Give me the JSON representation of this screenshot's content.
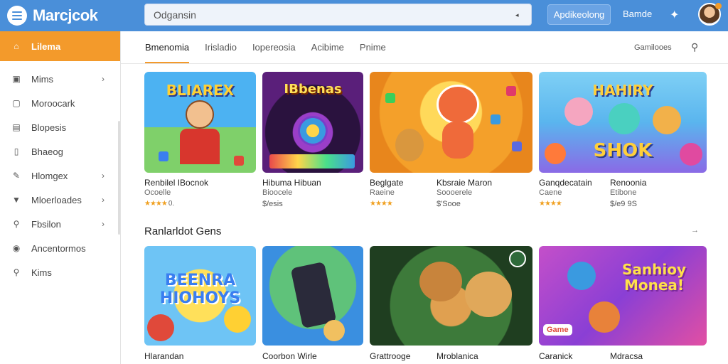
{
  "app": {
    "name": "Marcjcok"
  },
  "header": {
    "search_value": "Odgansin",
    "apps_button": "Apdikeolong",
    "games_link": "Bamde"
  },
  "sidebar": {
    "items": [
      {
        "label": "Lilema",
        "icon": "home-icon",
        "active": true,
        "chevron": false
      },
      {
        "label": "Mims",
        "icon": "image-icon",
        "chevron": true
      },
      {
        "label": "Moroocark",
        "icon": "window-icon",
        "chevron": false
      },
      {
        "label": "Blopesis",
        "icon": "document-icon",
        "chevron": false
      },
      {
        "label": "Bhaeog",
        "icon": "lock-icon",
        "chevron": false
      },
      {
        "label": "Hlomgex",
        "icon": "pen-icon",
        "chevron": true
      },
      {
        "label": "Mloerloades",
        "icon": "filter-icon",
        "chevron": true
      },
      {
        "label": "Fbsilon",
        "icon": "search-icon",
        "chevron": true
      },
      {
        "label": "Ancentormos",
        "icon": "compass-icon",
        "chevron": false
      },
      {
        "label": "Kims",
        "icon": "search-icon",
        "chevron": false
      }
    ]
  },
  "tabs": {
    "items": [
      "Bmenomia",
      "Irisladio",
      "Iopereosia",
      "Acibime",
      "Pnime"
    ],
    "right_label": "Gamilooes"
  },
  "row1": [
    {
      "thumb_title": "BLIAREX",
      "title": "Renbilel IBocnok",
      "sub": "Ocoelle",
      "stars": "★★★★",
      "rating": "0."
    },
    {
      "thumb_title": "IBbenas",
      "title": "Hibuma Hibuan",
      "sub": "Bioocele",
      "price": "$/esis"
    },
    {
      "title": "Beglgate",
      "sub": "Raeine",
      "stars": "★★★★"
    },
    {
      "title": "Kbsraie Maron",
      "sub": "Soooerele",
      "price": "$'Sooe"
    },
    {
      "title": "Ganqdecatain",
      "sub": "Caene",
      "stars": "★★★★"
    },
    {
      "thumb_title": "HAHIRY",
      "thumb_title2": "SHOK",
      "title": "Renoonia",
      "sub": "Etibone",
      "price": "$/e9 9S"
    }
  ],
  "section": {
    "title": "Ranlarldot Gens",
    "more": "→"
  },
  "row2": [
    {
      "thumb_title": "BEENRA HIOHOYS",
      "title": "Hlarandan"
    },
    {
      "title": "Coorbon Wirle"
    },
    {
      "title": "Grattrooge"
    },
    {
      "title": "Mroblanica"
    },
    {
      "thumb_title": "Sanhioy Monea!",
      "badge": "Game",
      "title": "Caranick"
    },
    {
      "title": "Mdracsa"
    }
  ]
}
